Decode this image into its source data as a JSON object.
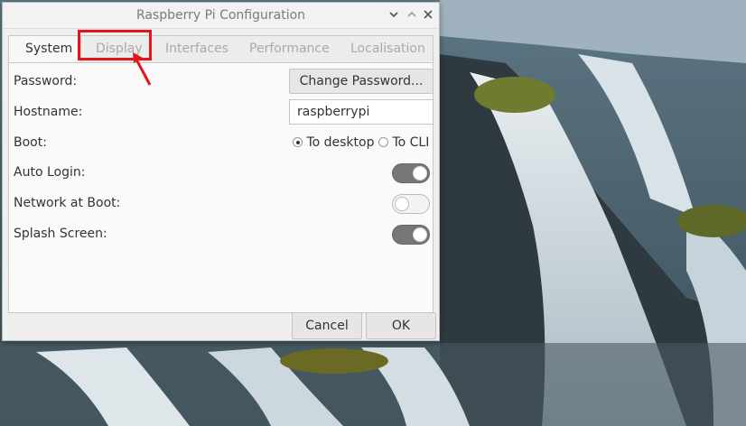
{
  "window": {
    "title": "Raspberry Pi Configuration"
  },
  "tabs": [
    {
      "label": "System",
      "active": true
    },
    {
      "label": "Display",
      "active": false
    },
    {
      "label": "Interfaces",
      "active": false
    },
    {
      "label": "Performance",
      "active": false
    },
    {
      "label": "Localisation",
      "active": false
    }
  ],
  "system": {
    "password_label": "Password:",
    "change_password_label": "Change Password...",
    "hostname_label": "Hostname:",
    "hostname_value": "raspberrypi",
    "boot_label": "Boot:",
    "boot_options": [
      "To desktop",
      "To CLI"
    ],
    "boot_selected": "To desktop",
    "auto_login_label": "Auto Login:",
    "auto_login": true,
    "network_boot_label": "Network at Boot:",
    "network_boot": false,
    "splash_label": "Splash Screen:",
    "splash": true
  },
  "footer": {
    "cancel_label": "Cancel",
    "ok_label": "OK"
  },
  "colors": {
    "annotation_red": "#e8141b",
    "toggle_on": "#777777"
  }
}
